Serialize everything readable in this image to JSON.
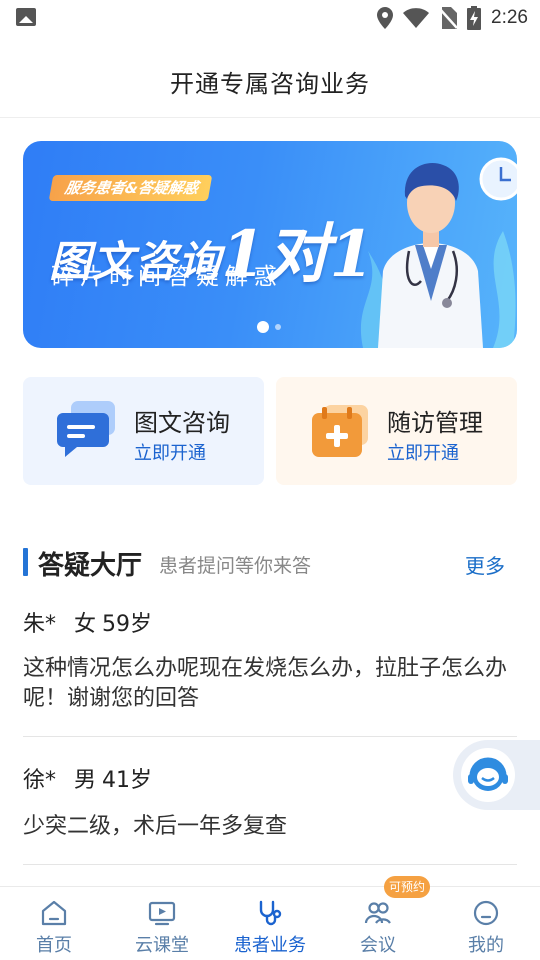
{
  "status_bar": {
    "time": "2:26"
  },
  "header": {
    "title": "开通专属咨询业务"
  },
  "banner": {
    "tag": "服务患者&答疑解惑",
    "headline": "图文咨询",
    "headline_big": "1对1",
    "subline": "碎片时间答疑解惑",
    "slide_count": 2,
    "active_slide": 1
  },
  "services": [
    {
      "title": "图文咨询",
      "action": "立即开通",
      "icon": "chat-bubble-icon"
    },
    {
      "title": "随访管理",
      "action": "立即开通",
      "icon": "medical-calendar-icon"
    }
  ],
  "qa_section": {
    "title": "答疑大厅",
    "subtitle": "患者提问等你来答",
    "more": "更多",
    "items": [
      {
        "name": "朱*",
        "gender": "女",
        "age": "59岁",
        "question": "这种情况怎么办呢现在发烧怎么办，拉肚子怎么办呢！谢谢您的回答"
      },
      {
        "name": "徐*",
        "gender": "男",
        "age": "41岁",
        "question": "少突二级，术后一年多复查"
      }
    ]
  },
  "float_button": {
    "icon": "customer-service-icon"
  },
  "tabbar": {
    "tabs": [
      {
        "label": "首页",
        "icon": "home-icon"
      },
      {
        "label": "云课堂",
        "icon": "video-icon"
      },
      {
        "label": "患者业务",
        "icon": "stethoscope-icon",
        "active": true
      },
      {
        "label": "会议",
        "icon": "meeting-icon",
        "badge": "可预约"
      },
      {
        "label": "我的",
        "icon": "profile-icon"
      }
    ]
  },
  "colors": {
    "accent": "#1b63cf",
    "banner_start": "#2f7df6",
    "banner_end": "#57b4fb",
    "badge": "#f5a142"
  }
}
